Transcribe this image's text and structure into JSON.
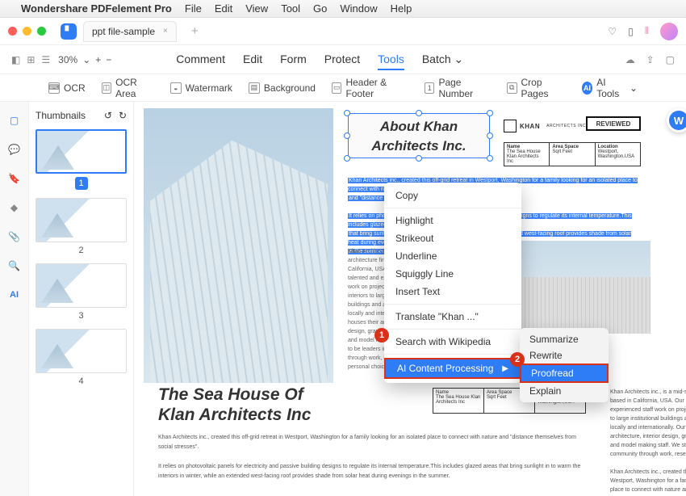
{
  "menubar": {
    "apple": "",
    "appname": "Wondershare PDFelement Pro",
    "items": [
      "File",
      "Edit",
      "View",
      "Tool",
      "Go",
      "Window",
      "Help"
    ]
  },
  "tab": {
    "title": "ppt file-sample",
    "close": "×",
    "add": "+"
  },
  "zoom": {
    "value": "30%",
    "down": "⌄",
    "plus": "+",
    "minus": "−"
  },
  "main_tabs": {
    "items": [
      "Comment",
      "Edit",
      "Form",
      "Protect",
      "Tools",
      "Batch"
    ],
    "active": "Tools",
    "batch_caret": "⌄"
  },
  "subbar": {
    "ocr": "OCR",
    "ocrarea": "OCR Area",
    "watermark": "Watermark",
    "background": "Background",
    "header": "Header & Footer",
    "pagenum": "Page Number",
    "crop": "Crop Pages",
    "ai": "AI Tools",
    "ai_caret": "⌄"
  },
  "thumbnails": {
    "title": "Thumbnails",
    "nums": [
      "1",
      "2",
      "3",
      "4"
    ]
  },
  "doc": {
    "about_title_l1": "About Khan",
    "about_title_l2": "Architects Inc.",
    "brand": "KHAN",
    "brand2": "ARCHITECTS INC.",
    "reviewed": "REVIEWED",
    "info_h1": "Name",
    "info_h2": "Area Space",
    "info_h3": "Location",
    "info_v1": "The Sea House Klan Architects Inc",
    "info_v2": "Sqrt Feet",
    "info_v3": "Westport, Washington,USA",
    "blue1": "Khan Architects inc., created this off-grid retreat in Westport, Washington for a family looking for an isolated place to connect with nature",
    "blue2": "and \"distance themselves from social stresses\".",
    "blue3": "It relies on photovoltaic panels for electricity and passive building designs to regulate its internal temperature.This includes glazed areas",
    "blue4": "that bring sunlight in to warm the interiors in winter, while an extended west-facing roof provides shade from solar heat during evenings",
    "blue5": "in the summer.",
    "plain": "Khan Architects inc., is a mid-sized architecture firm based in California, USA. Our exceptionally talented and experienced staff work on projects from boutique interiors to large institutional buildings and airport complexes, locally and internationally. Our firm houses their architecture, interior design, graphic design, landscape and model making staff. We strive to be leaders in the community through work, research and personal choices.",
    "seahouse_l1": "The Sea House Of",
    "seahouse_l2": "Klan Architects Inc",
    "lower1": "Khan Architects inc., created this off-grid retreat in Westport, Washington for a family looking for an isolated place to connect with nature and \"distance themselves from social stresses\".",
    "lower2": "It relies on photovoltaic panels for electricity and passive building designs to regulate its internal temperature.This includes glazed areas that bring sunlight in to warm the interiors in winter, while an extended west-facing roof provides shade from solar heat during evenings in the summer.",
    "rightcol1": "Khan Architects inc., is a mid-sized architecture firm based in California, USA. Our exceptionally talented and experienced staff work on projects from boutique interiors to large institutional buildings and airport complexes, locally and internationally. Our firm houses their architecture, interior design, graphic design, landscape and model making staff. We strive to be leaders in the community through work, research and personal choices.",
    "rightcol2": "Khan Architects inc., created this off-grid retreat in Westport, Washington for a family looking for an isolated place to connect with nature and"
  },
  "ctx": {
    "copy": "Copy",
    "highlight": "Highlight",
    "strikeout": "Strikeout",
    "underline": "Underline",
    "squiggly": "Squiggly Line",
    "insert": "Insert Text",
    "translate": "Translate \"Khan ...\"",
    "search": "Search with Wikipedia",
    "ai": "AI Content Processing",
    "sub": {
      "summarize": "Summarize",
      "rewrite": "Rewrite",
      "proofread": "Proofread",
      "explain": "Explain"
    }
  },
  "badges": {
    "one": "1",
    "two": "2"
  }
}
